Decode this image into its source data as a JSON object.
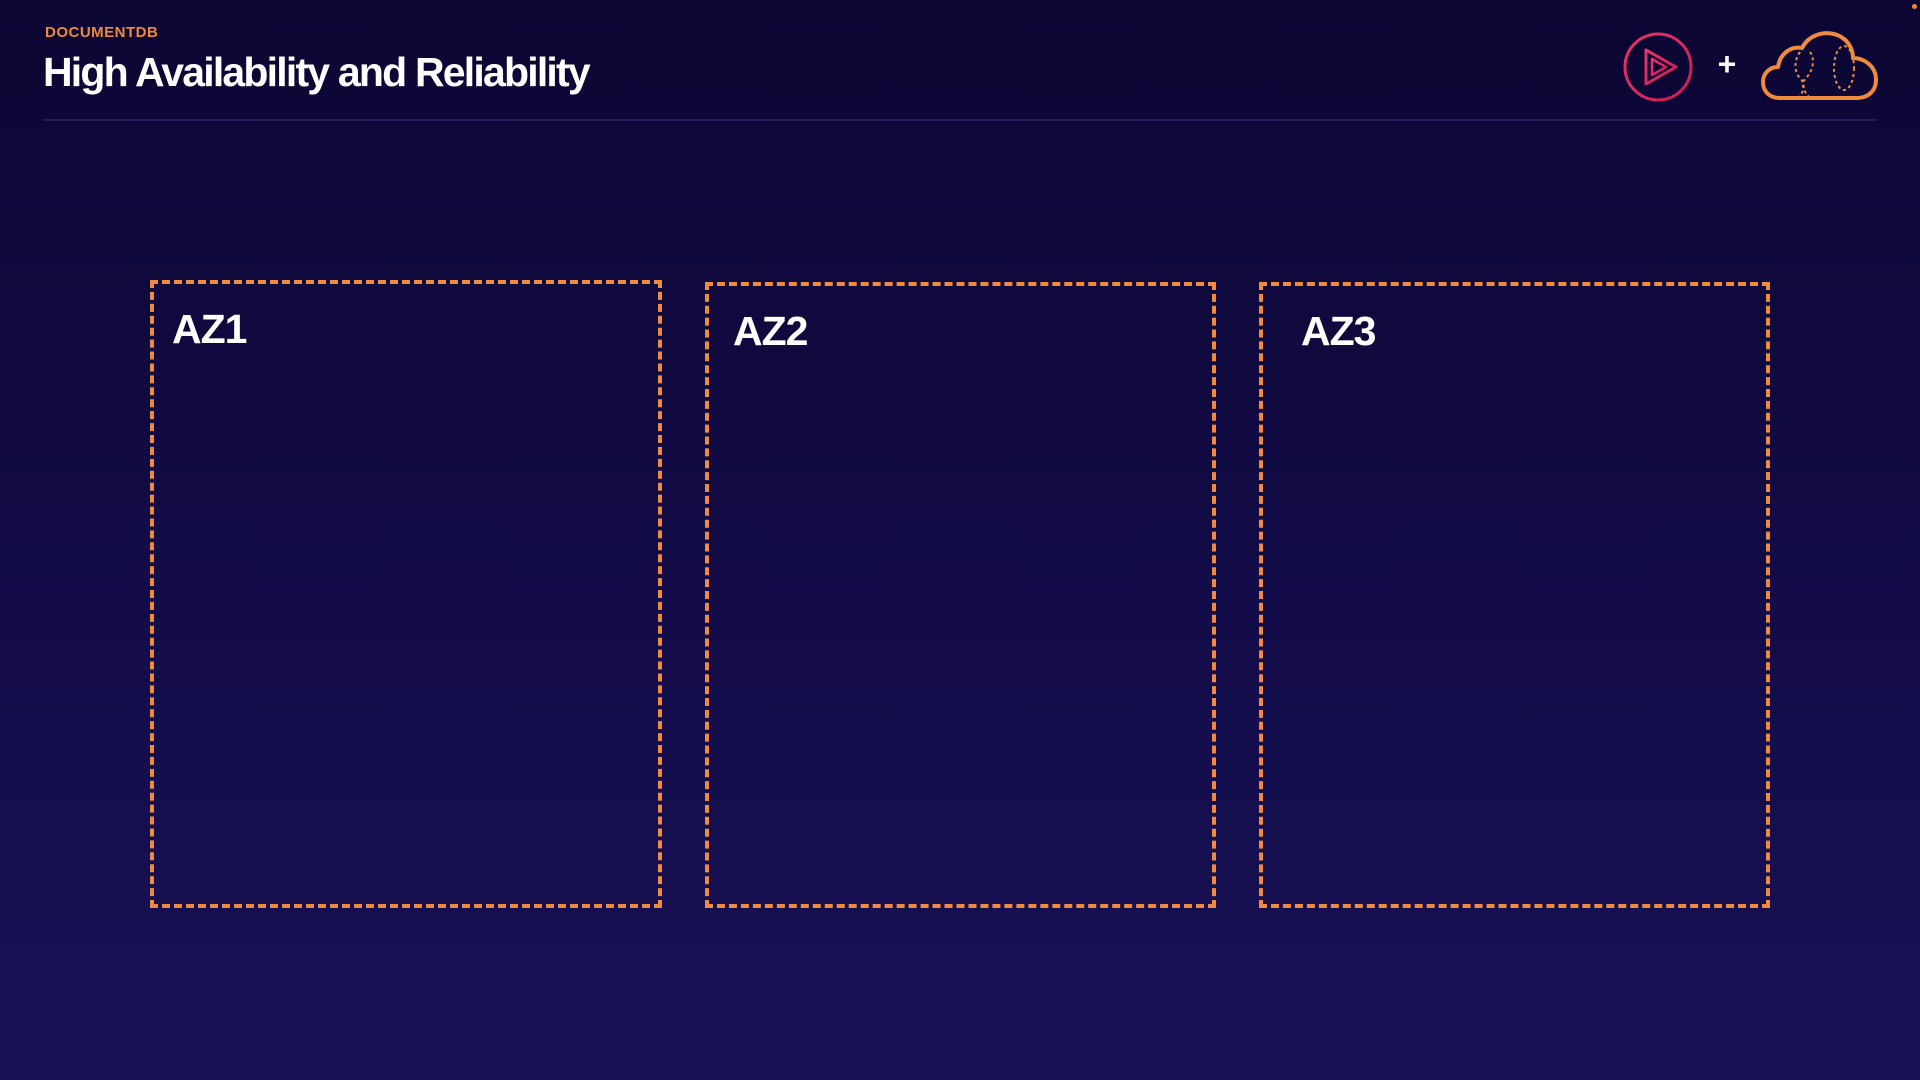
{
  "header": {
    "eyebrow": "DOCUMENTDB",
    "title": "High Availability and Reliability",
    "plus": "+"
  },
  "zones": [
    {
      "label": "AZ1"
    },
    {
      "label": "AZ2"
    },
    {
      "label": "AZ3"
    }
  ],
  "colors": {
    "accent_orange": "#ef8a3e",
    "play_logo_pink": "#e8336b",
    "background_top": "#0b0632",
    "background_bottom": "#181256"
  },
  "icons": [
    "play-logo-icon",
    "plus-icon",
    "cloud-logo-icon"
  ]
}
